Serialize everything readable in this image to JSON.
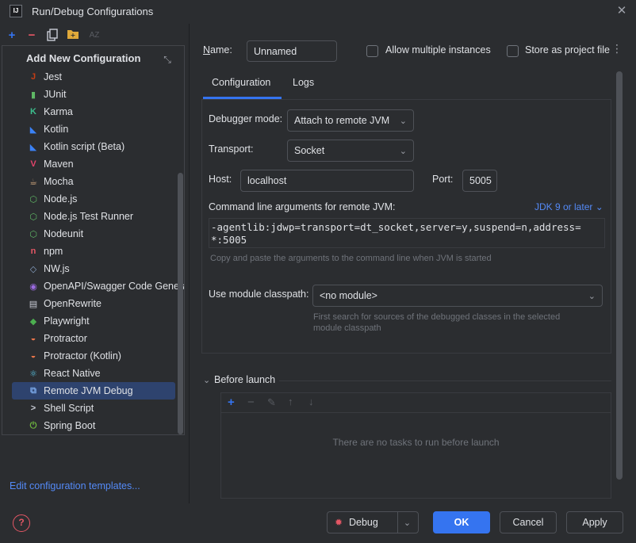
{
  "window": {
    "title": "Run/Debug Configurations",
    "logo": "IJ"
  },
  "toolbar": {
    "icons": [
      "add-icon",
      "remove-icon",
      "copy-icon",
      "folder-icon",
      "sort-icon"
    ],
    "colors": {
      "add": "#3574f0",
      "remove": "#e55765",
      "copy": "#c9ccd6",
      "folder": "#e0a93a",
      "sort": "#5a5d63"
    }
  },
  "list": {
    "header": "Add New Configuration",
    "items": [
      {
        "label": "Jest",
        "icon": "jest-icon",
        "glyph": "J",
        "color": "#c63d14"
      },
      {
        "label": "JUnit",
        "icon": "junit-icon",
        "glyph": "▮",
        "color": "#5fb865"
      },
      {
        "label": "Karma",
        "icon": "karma-icon",
        "glyph": "K",
        "color": "#3cbe8d"
      },
      {
        "label": "Kotlin",
        "icon": "kotlin-icon",
        "glyph": "◣",
        "color": "#3b82f6"
      },
      {
        "label": "Kotlin script (Beta)",
        "icon": "kotlin-script-icon",
        "glyph": "◣",
        "color": "#3b82f6"
      },
      {
        "label": "Maven",
        "icon": "maven-icon",
        "glyph": "V",
        "color": "#e0436a"
      },
      {
        "label": "Mocha",
        "icon": "mocha-icon",
        "glyph": "☕",
        "color": "#c8a27a"
      },
      {
        "label": "Node.js",
        "icon": "nodejs-icon",
        "glyph": "⬡",
        "color": "#5fb865"
      },
      {
        "label": "Node.js Test Runner",
        "icon": "nodejs-test-runner-icon",
        "glyph": "⬡",
        "color": "#5fb865"
      },
      {
        "label": "Nodeunit",
        "icon": "nodeunit-icon",
        "glyph": "⬡",
        "color": "#5fb865"
      },
      {
        "label": "npm",
        "icon": "npm-icon",
        "glyph": "n",
        "color": "#e55765"
      },
      {
        "label": "NW.js",
        "icon": "nwjs-icon",
        "glyph": "◇",
        "color": "#8aa4c8"
      },
      {
        "label": "OpenAPI/Swagger Code Generator",
        "icon": "openapi-icon",
        "glyph": "◉",
        "color": "#9b6be0"
      },
      {
        "label": "OpenRewrite",
        "icon": "openrewrite-icon",
        "glyph": "▤",
        "color": "#c9ccd6"
      },
      {
        "label": "Playwright",
        "icon": "playwright-icon",
        "glyph": "◆",
        "color": "#4caf50"
      },
      {
        "label": "Protractor",
        "icon": "protractor-icon",
        "glyph": "◒",
        "color": "#e8754a"
      },
      {
        "label": "Protractor (Kotlin)",
        "icon": "protractor-kotlin-icon",
        "glyph": "◒",
        "color": "#e8754a"
      },
      {
        "label": "React Native",
        "icon": "react-native-icon",
        "glyph": "⚛",
        "color": "#5ac8e8"
      },
      {
        "label": "Remote JVM Debug",
        "icon": "remote-jvm-debug-icon",
        "glyph": "⧉",
        "color": "#7aa7e8"
      },
      {
        "label": "Shell Script",
        "icon": "shell-script-icon",
        "glyph": ">",
        "color": "#c9ccd6"
      },
      {
        "label": "Spring Boot",
        "icon": "spring-boot-icon",
        "glyph": "⏻",
        "color": "#6db33f"
      }
    ],
    "selected_index": 18
  },
  "edit_templates": "Edit configuration templates...",
  "name": {
    "label": "Name:",
    "value": "Unnamed"
  },
  "allow_multiple": {
    "label": "Allow multiple instances"
  },
  "store_project": {
    "label": "Store as project file"
  },
  "tabs": [
    {
      "label": "Configuration",
      "active": true
    },
    {
      "label": "Logs",
      "active": false
    }
  ],
  "debugger_mode": {
    "label": "Debugger mode:",
    "value": "Attach to remote JVM"
  },
  "transport": {
    "label": "Transport:",
    "value": "Socket"
  },
  "host": {
    "label": "Host:",
    "value": "localhost"
  },
  "port": {
    "label": "Port:",
    "value": "5005"
  },
  "cmdline": {
    "label": "Command line arguments for remote JVM:",
    "jdk_link": "JDK 9 or later",
    "line1": "-agentlib:jdwp=transport=dt_socket,server=y,suspend=n,address=",
    "line2": "*:5005",
    "hint": "Copy and paste the arguments to the command line when JVM is started"
  },
  "module_classpath": {
    "label": "Use module classpath:",
    "value": "<no module>",
    "hint_line1": "First search for sources of the debugged classes in the selected",
    "hint_line2": "module classpath"
  },
  "before_launch": {
    "label": "Before launch",
    "empty_text": "There are no tasks to run before launch"
  },
  "buttons": {
    "debug": "Debug",
    "ok": "OK",
    "cancel": "Cancel",
    "apply": "Apply"
  },
  "help_glyph": "?"
}
